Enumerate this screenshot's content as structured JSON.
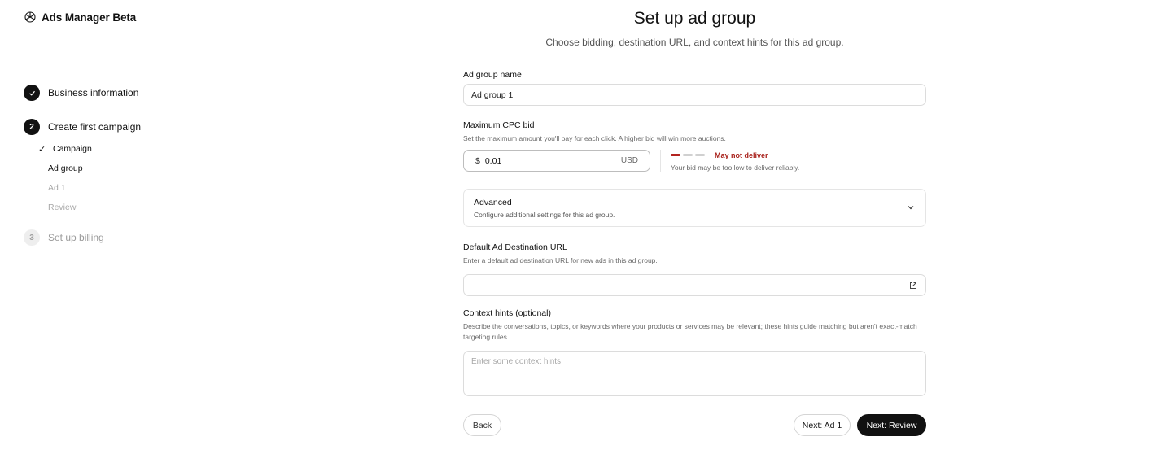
{
  "brand": {
    "name": "Ads Manager Beta",
    "icon": "openai-logo-icon"
  },
  "steps": [
    {
      "number": "✓",
      "label": "Business information",
      "state": "done"
    },
    {
      "number": "2",
      "label": "Create first campaign",
      "state": "current"
    },
    {
      "number": "3",
      "label": "Set up billing",
      "state": "pending"
    }
  ],
  "substeps": [
    {
      "label": "Campaign",
      "state": "done"
    },
    {
      "label": "Ad group",
      "state": "current"
    },
    {
      "label": "Ad 1",
      "state": "pending"
    },
    {
      "label": "Review",
      "state": "pending"
    }
  ],
  "page": {
    "title": "Set up ad group",
    "subtitle": "Choose bidding, destination URL, and context hints for this ad group."
  },
  "form": {
    "ad_group_name": {
      "label": "Ad group name",
      "value": "Ad group 1"
    },
    "cpc": {
      "label": "Maximum CPC bid",
      "help": "Set the maximum amount you'll pay for each click. A higher bid will win more auctions.",
      "currency_symbol": "$",
      "value": "0.01",
      "currency": "USD",
      "status": "May not deliver",
      "status_help": "Your bid may be too low to deliver reliably.",
      "strength_level": "1 of 3"
    },
    "advanced": {
      "title": "Advanced",
      "subtitle": "Configure additional settings for this ad group."
    },
    "url": {
      "label": "Default Ad Destination URL",
      "help": "Enter a default ad destination URL for new ads in this ad group.",
      "value": ""
    },
    "hints": {
      "label": "Context hints (optional)",
      "help": "Describe the conversations, topics, or keywords where your products or services may be relevant; these hints guide matching but aren't exact-match targeting rules.",
      "placeholder": "Enter some context hints"
    }
  },
  "actions": {
    "back": "Back",
    "next_ad": "Next: Ad 1",
    "next_review": "Next: Review"
  },
  "colors": {
    "accent": "#111111",
    "warning": "#a8201a"
  }
}
